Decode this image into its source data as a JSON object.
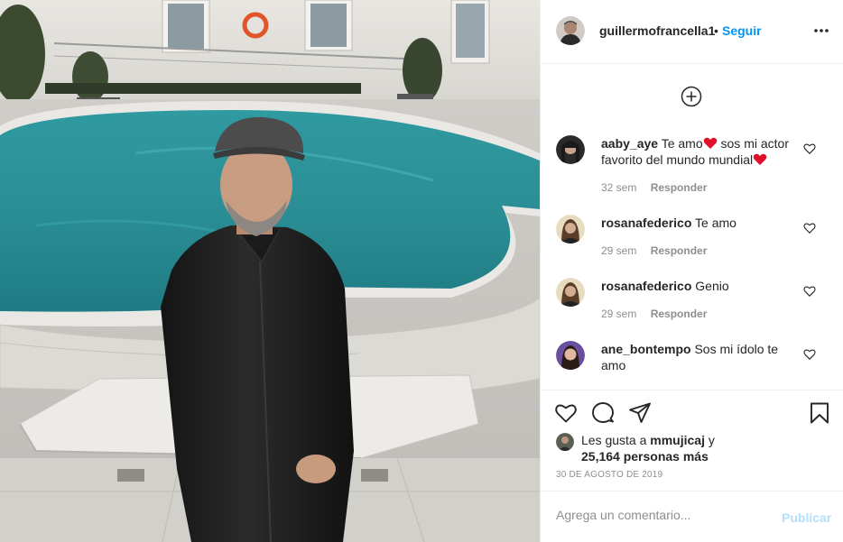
{
  "post": {
    "author": "guillermofrancella1",
    "separator": "•",
    "follow_label": "Seguir",
    "more_icon": "more-options-icon",
    "load_more_icon": "plus-circle-icon"
  },
  "comments": [
    {
      "user": "aaby_aye",
      "text_parts": [
        "Te amo",
        " sos mi actor favorito del mundo mundial"
      ],
      "time": "32 sem",
      "reply_label": "Responder"
    },
    {
      "user": "rosanafederico",
      "text": "Te amo",
      "time": "29 sem",
      "reply_label": "Responder"
    },
    {
      "user": "rosanafederico",
      "text": "Genio",
      "time": "29 sem",
      "reply_label": "Responder"
    },
    {
      "user": "ane_bontempo",
      "text": "Sos mi ídolo te amo"
    }
  ],
  "actions": {
    "icons": [
      "heart-icon",
      "comment-icon",
      "share-icon",
      "bookmark-icon"
    ]
  },
  "likes": {
    "prefix": "Les gusta a",
    "user": "mmujicaj",
    "conj": "y",
    "count": "25,164 personas más"
  },
  "date": "30 DE AGOSTO DE 2019",
  "add_comment": {
    "placeholder": "Agrega un comentario...",
    "post_label": "Publicar"
  },
  "colors": {
    "link_blue": "#0095f6",
    "post_disabled": "#b2dffc",
    "muted": "#8e8e8e",
    "emoji_heart": "#e0102b"
  }
}
